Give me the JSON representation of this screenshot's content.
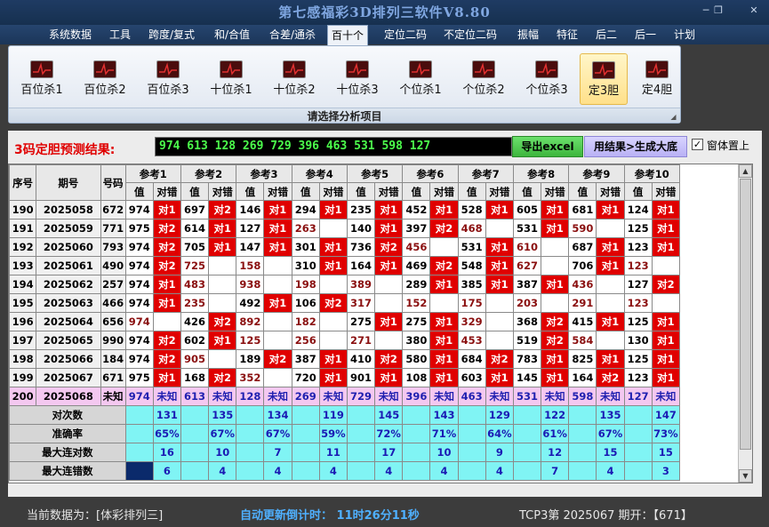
{
  "window": {
    "title": "第七感福彩3D排列三软件V8.80"
  },
  "menu": [
    "系统数据",
    "工具",
    "跨度/复式",
    "和/合值",
    "合差/通杀",
    "百十个",
    "定位二码",
    "不定位二码",
    "振幅",
    "特征",
    "后二",
    "后一",
    "计划"
  ],
  "menu_active": "百十个",
  "ribbon": {
    "buttons": [
      "百位杀1",
      "百位杀2",
      "百位杀3",
      "十位杀1",
      "十位杀2",
      "十位杀3",
      "个位杀1",
      "个位杀2",
      "个位杀3",
      "定3胆",
      "定4胆"
    ],
    "active": "定3胆",
    "footer": "请选择分析项目"
  },
  "result": {
    "label": "3码定胆预测结果:",
    "value": "974 613 128 269 729 396 463 531 598 127",
    "excel_button": "导出excel",
    "generate_button": "用结果>生成大底",
    "topmost_checked": "✓",
    "topmost_label": "窗体置上"
  },
  "table": {
    "headers": {
      "seq": "序号",
      "period": "期号",
      "number": "号码",
      "value": "值",
      "check": "对错"
    },
    "refs": [
      "参考1",
      "参考2",
      "参考3",
      "参考4",
      "参考5",
      "参考6",
      "参考7",
      "参考8",
      "参考9",
      "参考10"
    ],
    "rows": [
      {
        "seq": "190",
        "period": "2025058",
        "number": "672",
        "cells": [
          [
            "974",
            "对1"
          ],
          [
            "697",
            "对2"
          ],
          [
            "146",
            "对1"
          ],
          [
            "294",
            "对1"
          ],
          [
            "235",
            "对1"
          ],
          [
            "452",
            "对1"
          ],
          [
            "528",
            "对1"
          ],
          [
            "605",
            "对1"
          ],
          [
            "681",
            "对1"
          ],
          [
            "124",
            "对1"
          ]
        ]
      },
      {
        "seq": "191",
        "period": "2025059",
        "number": "771",
        "cells": [
          [
            "975",
            "对2"
          ],
          [
            "614",
            "对1"
          ],
          [
            "127",
            "对1"
          ],
          [
            "263",
            ""
          ],
          [
            "140",
            "对1"
          ],
          [
            "397",
            "对2"
          ],
          [
            "468",
            ""
          ],
          [
            "531",
            "对1"
          ],
          [
            "590",
            ""
          ],
          [
            "125",
            "对1"
          ]
        ]
      },
      {
        "seq": "192",
        "period": "2025060",
        "number": "793",
        "cells": [
          [
            "974",
            "对2"
          ],
          [
            "705",
            "对1"
          ],
          [
            "147",
            "对1"
          ],
          [
            "301",
            "对1"
          ],
          [
            "736",
            "对2"
          ],
          [
            "456",
            ""
          ],
          [
            "531",
            "对1"
          ],
          [
            "610",
            ""
          ],
          [
            "687",
            "对1"
          ],
          [
            "123",
            "对1"
          ]
        ]
      },
      {
        "seq": "193",
        "period": "2025061",
        "number": "490",
        "cells": [
          [
            "974",
            "对2"
          ],
          [
            "725",
            ""
          ],
          [
            "158",
            ""
          ],
          [
            "310",
            "对1"
          ],
          [
            "164",
            "对1"
          ],
          [
            "469",
            "对2"
          ],
          [
            "548",
            "对1"
          ],
          [
            "627",
            ""
          ],
          [
            "706",
            "对1"
          ],
          [
            "123",
            ""
          ]
        ]
      },
      {
        "seq": "194",
        "period": "2025062",
        "number": "257",
        "cells": [
          [
            "974",
            "对1"
          ],
          [
            "483",
            ""
          ],
          [
            "938",
            ""
          ],
          [
            "198",
            ""
          ],
          [
            "389",
            ""
          ],
          [
            "289",
            "对1"
          ],
          [
            "385",
            "对1"
          ],
          [
            "387",
            "对1"
          ],
          [
            "436",
            ""
          ],
          [
            "127",
            "对2"
          ]
        ]
      },
      {
        "seq": "195",
        "period": "2025063",
        "number": "466",
        "cells": [
          [
            "974",
            "对1"
          ],
          [
            "235",
            ""
          ],
          [
            "492",
            "对1"
          ],
          [
            "106",
            "对2"
          ],
          [
            "317",
            ""
          ],
          [
            "152",
            ""
          ],
          [
            "175",
            ""
          ],
          [
            "203",
            ""
          ],
          [
            "291",
            ""
          ],
          [
            "123",
            ""
          ]
        ]
      },
      {
        "seq": "196",
        "period": "2025064",
        "number": "656",
        "cells": [
          [
            "974",
            ""
          ],
          [
            "426",
            "对2"
          ],
          [
            "892",
            ""
          ],
          [
            "182",
            ""
          ],
          [
            "275",
            "对1"
          ],
          [
            "275",
            "对1"
          ],
          [
            "329",
            ""
          ],
          [
            "368",
            "对2"
          ],
          [
            "415",
            "对1"
          ],
          [
            "125",
            "对1"
          ]
        ]
      },
      {
        "seq": "197",
        "period": "2025065",
        "number": "990",
        "cells": [
          [
            "974",
            "对2"
          ],
          [
            "602",
            "对1"
          ],
          [
            "125",
            ""
          ],
          [
            "256",
            ""
          ],
          [
            "271",
            ""
          ],
          [
            "380",
            "对1"
          ],
          [
            "453",
            ""
          ],
          [
            "519",
            "对2"
          ],
          [
            "584",
            ""
          ],
          [
            "130",
            "对1"
          ]
        ]
      },
      {
        "seq": "198",
        "period": "2025066",
        "number": "184",
        "cells": [
          [
            "974",
            "对2"
          ],
          [
            "905",
            ""
          ],
          [
            "189",
            "对2"
          ],
          [
            "387",
            "对1"
          ],
          [
            "410",
            "对2"
          ],
          [
            "580",
            "对1"
          ],
          [
            "684",
            "对2"
          ],
          [
            "783",
            "对1"
          ],
          [
            "825",
            "对1"
          ],
          [
            "125",
            "对1"
          ]
        ]
      },
      {
        "seq": "199",
        "period": "2025067",
        "number": "671",
        "cells": [
          [
            "975",
            "对1"
          ],
          [
            "168",
            "对2"
          ],
          [
            "352",
            ""
          ],
          [
            "720",
            "对1"
          ],
          [
            "901",
            "对1"
          ],
          [
            "108",
            "对1"
          ],
          [
            "603",
            "对1"
          ],
          [
            "145",
            "对1"
          ],
          [
            "164",
            "对2"
          ],
          [
            "123",
            "对1"
          ]
        ]
      },
      {
        "seq": "200",
        "period": "2025068",
        "number": "未知",
        "pending": true,
        "cells": [
          [
            "974",
            "未知"
          ],
          [
            "613",
            "未知"
          ],
          [
            "128",
            "未知"
          ],
          [
            "269",
            "未知"
          ],
          [
            "729",
            "未知"
          ],
          [
            "396",
            "未知"
          ],
          [
            "463",
            "未知"
          ],
          [
            "531",
            "未知"
          ],
          [
            "598",
            "未知"
          ],
          [
            "127",
            "未知"
          ]
        ]
      }
    ],
    "stats": [
      {
        "label": "对次数",
        "values": [
          "131",
          "135",
          "134",
          "119",
          "145",
          "143",
          "129",
          "122",
          "135",
          "147"
        ]
      },
      {
        "label": "准确率",
        "values": [
          "65%",
          "67%",
          "67%",
          "59%",
          "72%",
          "71%",
          "64%",
          "61%",
          "67%",
          "73%"
        ]
      },
      {
        "label": "最大连对数",
        "values": [
          "16",
          "10",
          "7",
          "11",
          "17",
          "10",
          "9",
          "12",
          "15",
          "15"
        ]
      },
      {
        "label": "最大连错数",
        "values": [
          "6",
          "4",
          "4",
          "4",
          "4",
          "4",
          "4",
          "7",
          "4",
          "3"
        ]
      }
    ]
  },
  "status": {
    "current": "当前数据为：[体彩排列三]",
    "countdown": "自动更新倒计时： 11时26分11秒",
    "period": "TCP3第 2025067 期开：【671】"
  }
}
